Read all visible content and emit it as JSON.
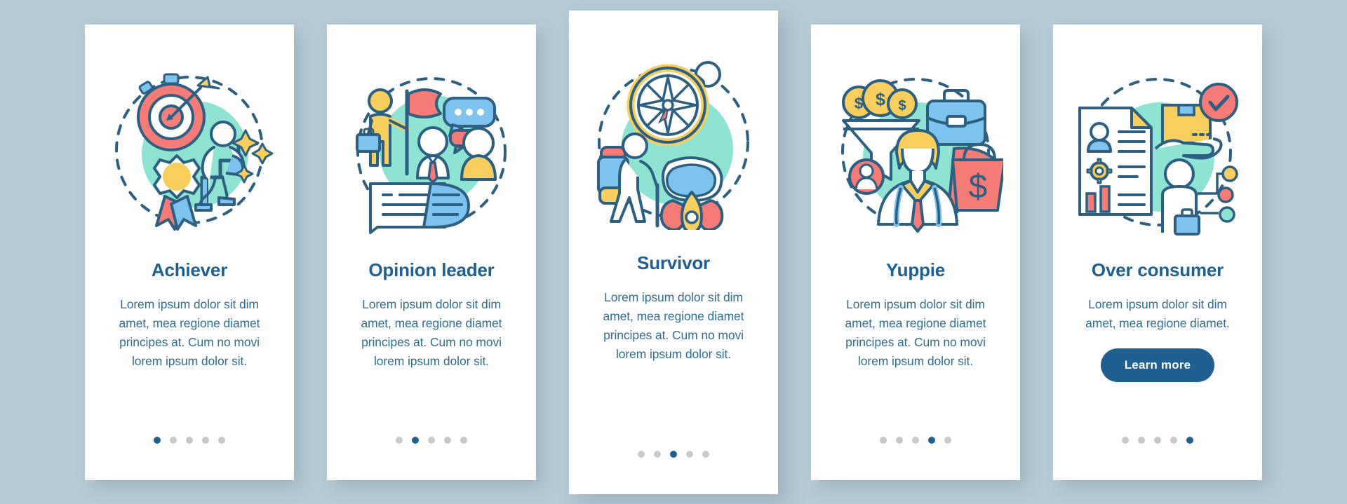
{
  "background_color": "#b7cbd7",
  "accent_color": "#1f6091",
  "text_color": "#2f6e90",
  "dot_inactive_color": "#c6c9cb",
  "cards": [
    {
      "id": "achiever",
      "title": "Achiever",
      "body": "Lorem ipsum dolor sit dim amet, mea regione diamet principes at. Cum no movi lorem ipsum dolor sit.",
      "illustration": "target-arrow-medal-stairs-icon",
      "dots": {
        "total": 5,
        "active_index": 0
      },
      "button": null
    },
    {
      "id": "opinion-leader",
      "title": "Opinion leader",
      "body": "Lorem ipsum dolor sit dim amet, mea regione diamet principes at. Cum no movi lorem ipsum dolor sit.",
      "illustration": "flag-speech-bubbles-people-icon",
      "dots": {
        "total": 5,
        "active_index": 1
      },
      "button": null
    },
    {
      "id": "survivor",
      "title": "Survivor",
      "body": "Lorem ipsum dolor sit dim amet, mea regione diamet principes at. Cum no movi lorem ipsum dolor sit.",
      "illustration": "compass-hiker-gasmask-icon",
      "dots": {
        "total": 5,
        "active_index": 2
      },
      "button": null
    },
    {
      "id": "yuppie",
      "title": "Yuppie",
      "body": "Lorem ipsum dolor sit dim amet, mea regione diamet principes at. Cum no movi lorem ipsum dolor sit.",
      "illustration": "coins-funnel-briefcase-businessman-shoppingbag-icon",
      "dots": {
        "total": 5,
        "active_index": 3
      },
      "button": null
    },
    {
      "id": "over-consumer",
      "title": "Over consumer",
      "body": "Lorem ipsum dolor sit dim amet, mea regione diamet.",
      "illustration": "document-handbox-person-icon",
      "dots": {
        "total": 5,
        "active_index": 4
      },
      "button": {
        "label": "Learn more"
      }
    }
  ]
}
